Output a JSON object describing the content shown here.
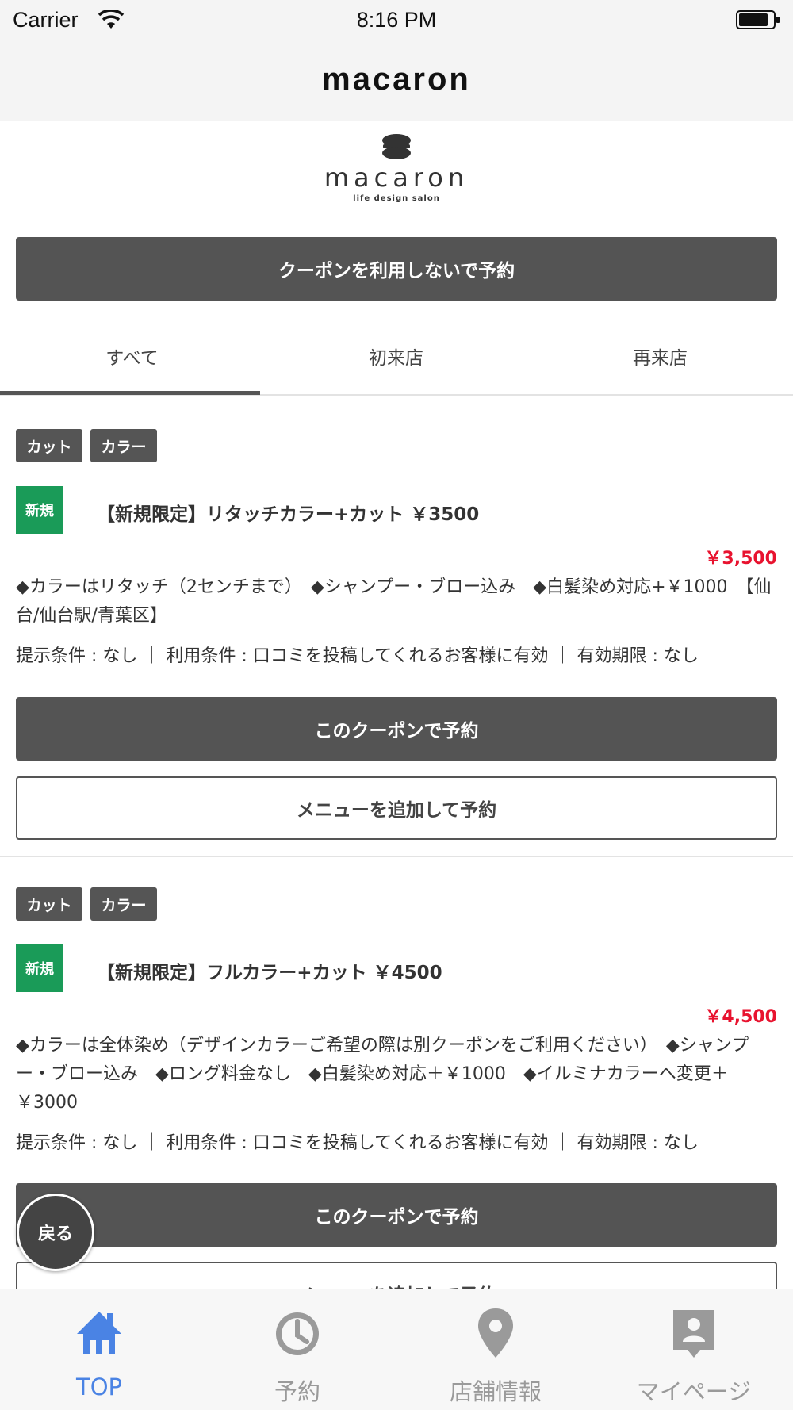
{
  "status_bar": {
    "carrier": "Carrier",
    "time": "8:16 PM"
  },
  "nav": {
    "title": "macaron"
  },
  "logo": {
    "name": "macaron",
    "tagline": "life design salon"
  },
  "no_coupon_button": "クーポンを利用しないで予約",
  "tabs": [
    {
      "label": "すべて",
      "selected": true
    },
    {
      "label": "初来店",
      "selected": false
    },
    {
      "label": "再来店",
      "selected": false
    }
  ],
  "coupons": [
    {
      "tags": [
        "カット",
        "カラー"
      ],
      "badge": "新規",
      "title": "【新規限定】リタッチカラー+カット ￥3500",
      "price": "￥3,500",
      "description": "◆カラーはリタッチ（2センチまで）　◆シャンプー・ブロー込み　◆白髪染め対応+￥1000　【仙台/仙台駅/青葉区】",
      "conditions": "提示条件 : なし ｜ 利用条件 : 口コミを投稿してくれるお客様に有効 ｜ 有効期限 : なし",
      "reserve_label": "このクーポンで予約",
      "add_menu_label": "メニューを追加して予約"
    },
    {
      "tags": [
        "カット",
        "カラー"
      ],
      "badge": "新規",
      "title": "【新規限定】フルカラー+カット ￥4500",
      "price": "￥4,500",
      "description": "◆カラーは全体染め（デザインカラーご希望の際は別クーポンをご利用ください）　◆シャンプー・ブロー込み　◆ロング料金なし　◆白髪染め対応＋￥1000　◆イルミナカラーへ変更＋￥3000",
      "conditions": "提示条件 : なし ｜ 利用条件 : 口コミを投稿してくれるお客様に有効 ｜ 有効期限 : なし",
      "reserve_label": "このクーポンで予約",
      "add_menu_label": "メニューを追加して予約"
    }
  ],
  "back_button": "戻る",
  "tab_bar": [
    {
      "label": "TOP",
      "icon": "home-icon",
      "active": true
    },
    {
      "label": "予約",
      "icon": "clock-icon",
      "active": false
    },
    {
      "label": "店舗情報",
      "icon": "location-pin-icon",
      "active": false
    },
    {
      "label": "マイページ",
      "icon": "id-card-icon",
      "active": false
    }
  ],
  "colors": {
    "accent_blue": "#4a83e4",
    "price_red": "#e8132f",
    "badge_green": "#1a9b58",
    "button_dark": "#545454"
  }
}
